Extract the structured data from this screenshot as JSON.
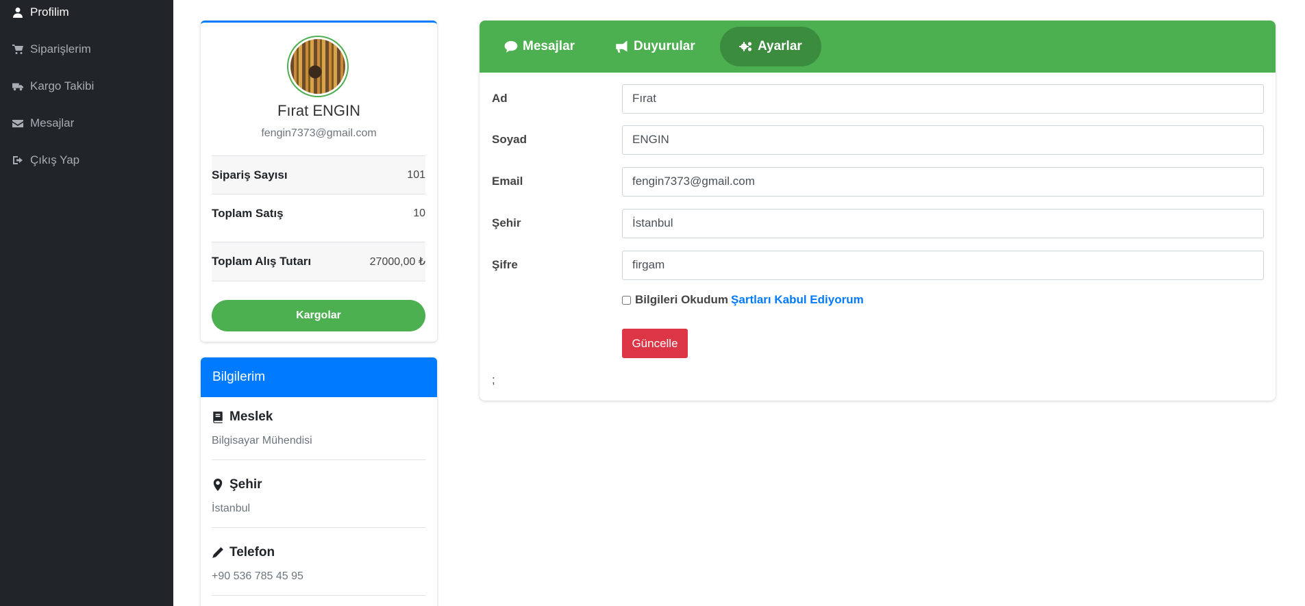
{
  "sidebar": {
    "items": [
      {
        "label": "Profilim",
        "icon": "user-icon"
      },
      {
        "label": "Siparişlerim",
        "icon": "cart-icon"
      },
      {
        "label": "Kargo Takibi",
        "icon": "truck-icon"
      },
      {
        "label": "Mesajlar",
        "icon": "envelope-icon"
      },
      {
        "label": "Çıkış Yap",
        "icon": "sign-out-icon"
      }
    ]
  },
  "profile": {
    "name": "Fırat ENGIN",
    "email": "fengin7373@gmail.com",
    "stats": [
      {
        "label": "Sipariş Sayısı",
        "value": "101"
      },
      {
        "label": "Toplam Satış",
        "value": "10"
      },
      {
        "label": "Toplam Alış Tutarı",
        "value": "27000,00 ₺"
      }
    ],
    "button": "Kargolar"
  },
  "info": {
    "header": "Bilgilerim",
    "items": [
      {
        "title": "Meslek",
        "value": "Bilgisayar Mühendisi",
        "icon": "book-icon"
      },
      {
        "title": "Şehir",
        "value": "İstanbul",
        "icon": "map-marker-icon"
      },
      {
        "title": "Telefon",
        "value": "+90 536 785 45 95",
        "icon": "pencil-icon"
      }
    ]
  },
  "tabs": [
    {
      "label": "Mesajlar",
      "icon": "comment-icon"
    },
    {
      "label": "Duyurular",
      "icon": "bullhorn-icon"
    },
    {
      "label": "Ayarlar",
      "icon": "cogs-icon",
      "active": true
    }
  ],
  "form": {
    "fields": [
      {
        "label": "Ad",
        "value": "Fırat"
      },
      {
        "label": "Soyad",
        "value": "ENGIN"
      },
      {
        "label": "Email",
        "value": "fengin7373@gmail.com"
      },
      {
        "label": "Şehir",
        "value": "İstanbul"
      },
      {
        "label": "Şifre",
        "value": "firgam"
      }
    ],
    "terms_text": "Bilgileri Okudum",
    "terms_link": "Şartları Kabul Ediyorum",
    "submit": "Güncelle",
    "trailing_text": ";"
  },
  "colors": {
    "sidebar_bg": "#212529",
    "accent_green": "#4caf50",
    "accent_blue": "#007bff",
    "danger": "#dc3545"
  }
}
